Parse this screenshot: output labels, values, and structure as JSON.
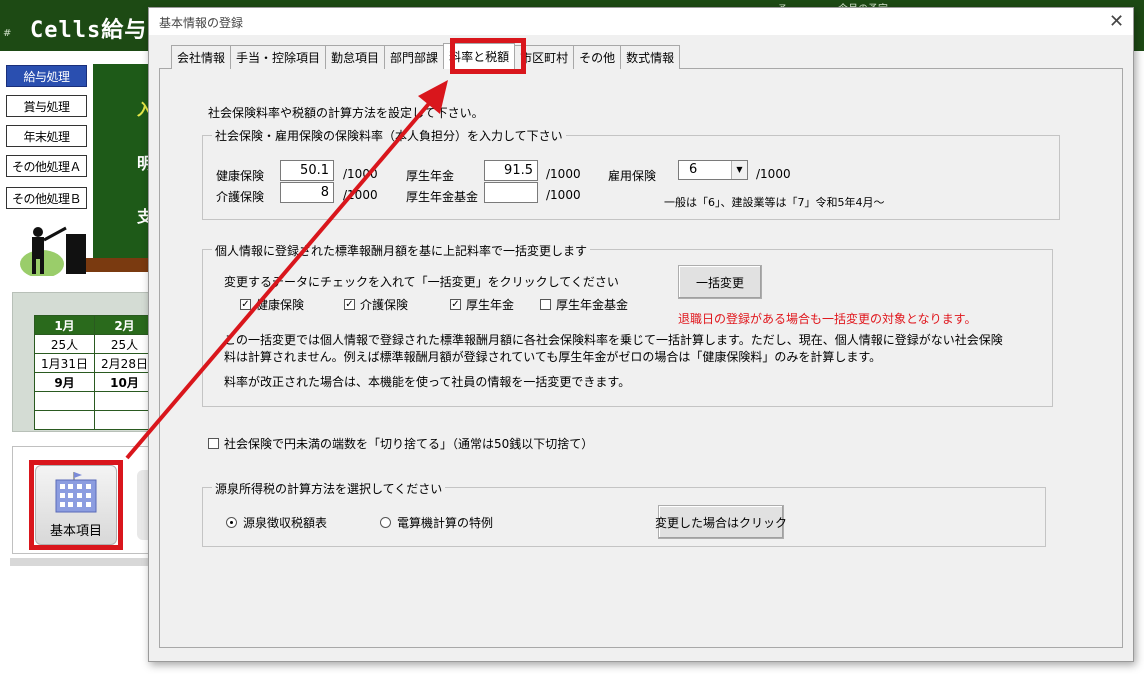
{
  "background": {
    "title": "Cells給与",
    "hash": "#",
    "header_right": "今月の予定",
    "header_dot": "予",
    "side_buttons": [
      "給与処理",
      "賞与処理",
      "年末処理",
      "その他処理Ａ",
      "その他処理Ｂ"
    ],
    "board_texts": [
      "入",
      "明",
      "支"
    ],
    "calendar": {
      "headers": [
        "1月",
        "2月"
      ],
      "rows": [
        [
          "25人",
          "25人"
        ],
        [
          "1月31日",
          "2月28日"
        ],
        [
          "9月",
          "10月"
        ],
        [
          "",
          ""
        ],
        [
          "",
          ""
        ]
      ]
    },
    "kihon_label": "基本項目"
  },
  "dialog": {
    "title": "基本情報の登録",
    "close": "✕",
    "tabs": [
      "会社情報",
      "手当・控除項目",
      "勤怠項目",
      "部門部課",
      "料率と税額",
      "市区町村",
      "その他",
      "数式情報"
    ],
    "selected_tab": "料率と税額",
    "intro": "社会保険料率や税額の計算方法を設定して下さい。",
    "insurance_group": {
      "legend": "社会保険・雇用保険の保険料率（本人負担分）を入力して下さい",
      "health": {
        "label": "健康保険",
        "value": "50.1",
        "unit": "/1000"
      },
      "care": {
        "label": "介護保険",
        "value": "8",
        "unit": "/1000"
      },
      "pension": {
        "label": "厚生年金",
        "value": "91.5",
        "unit": "/1000"
      },
      "pension_fund": {
        "label": "厚生年金基金",
        "value": "",
        "unit": "/1000"
      },
      "employment": {
        "label": "雇用保険",
        "value": "6",
        "unit": "/1000"
      },
      "employment_note": "一般は「6」、建設業等は「7」令和5年4月～"
    },
    "bulk_group": {
      "legend": "個人情報に登録された標準報酬月額を基に上記料率で一括変更します",
      "instruction": "変更するデータにチェックを入れて「一括変更」をクリックしてください",
      "checks": [
        {
          "label": "健康保険",
          "checked": true
        },
        {
          "label": "介護保険",
          "checked": true
        },
        {
          "label": "厚生年金",
          "checked": true
        },
        {
          "label": "厚生年金基金",
          "checked": false
        }
      ],
      "button": "一括変更",
      "warning": "退職日の登録がある場合も一括変更の対象となります。",
      "desc1": "この一括変更では個人情報で登録された標準報酬月額に各社会保険料率を乗じて一括計算します。ただし、現在、個人情報に登録がない社会保険料は計算されません。例えば標準報酬月額が登録されていても厚生年金がゼロの場合は「健康保険料」のみを計算します。",
      "desc2": "料率が改正された場合は、本機能を使って社員の情報を一括変更できます。"
    },
    "round_option": {
      "label": "社会保険で円未満の端数を「切り捨てる」（通常は50銭以下切捨て）",
      "checked": false
    },
    "tax_group": {
      "legend": "源泉所得税の計算方法を選択してください",
      "options": [
        {
          "label": "源泉徴収税額表",
          "selected": true
        },
        {
          "label": "電算機計算の特例",
          "selected": false
        }
      ],
      "button": "変更した場合はクリック"
    }
  },
  "colors": {
    "highlight": "#d9161c",
    "header_green": "#1d4a14",
    "active_blue": "#2a4fb0"
  }
}
